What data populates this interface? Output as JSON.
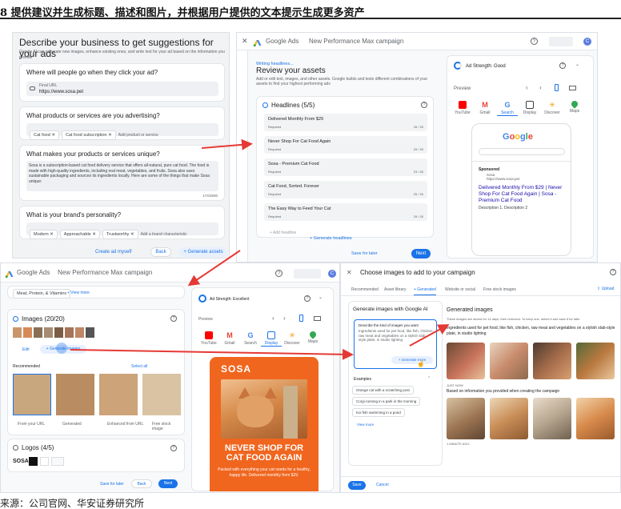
{
  "header": {
    "title": "8 提供建议并生成标题、描述和图片，并根据用户提供的文本提示生成更多资产"
  },
  "footer": {
    "source": "来源：公司官网、华安证券研究所"
  },
  "colors": {
    "accent": "#1a73e8",
    "arrow": "#e53935",
    "sosa_orange": "#f0661f"
  },
  "panel1": {
    "title": "Describe your business to get suggestions for your ads",
    "subtitle": "Google AI can generate new images, enhance existing ones, and write text for your ad based on the information you provide",
    "q1": "Where will people go when they click your ad?",
    "final_url_label": "Final URL",
    "final_url_value": "https://www.sosa.pet",
    "q2": "What products or services are you advertising?",
    "chips2": [
      "Cat food ✕",
      "Cat food subscription ✕"
    ],
    "add_product": "Add product or service",
    "q3": "What makes your products or services unique?",
    "unique_text": "Sosa is a subscription-based cat food delivery service that offers all-natural, pure cat food. The food is made with high-quality ingredients, including real meat, vegetables, and fruits. Sosa also uses sustainable packaging and sources its ingredients locally. Here are some of the things that make Sosa unique:",
    "counter": "174/2500",
    "q4": "What is your brand's personality?",
    "chips4": [
      "Modern ✕",
      "Approachable ✕",
      "Trustworthy ✕"
    ],
    "add_brand": "Add a brand characteristic",
    "create_manually": "Create ad myself",
    "back": "Back",
    "generate": "+ Generate assets"
  },
  "panel2": {
    "brand": "Google Ads",
    "campaign": "New Performance Max campaign",
    "writing": "Writing headlines...",
    "title": "Review your assets",
    "subtitle": "Add or edit text, images, and other assets. Google builds and tests different combinations of your assets to find your highest performing ads",
    "headlines_label": "Headlines (5/5)",
    "required": "Required",
    "headlines": [
      {
        "text": "Delivered Monthly From $29",
        "count": "26 / 30"
      },
      {
        "text": "Never Shop For Cat Food Again",
        "count": "29 / 30"
      },
      {
        "text": "Sosa - Premium Cat Food",
        "count": "23 / 30"
      },
      {
        "text": "Cat Food, Sorted. Forever",
        "count": "25 / 30"
      },
      {
        "text": "The Easy Way to Feed Your Cat",
        "count": "29 / 30"
      }
    ],
    "add_headline": "+ Add headline",
    "gen_headlines": "+ Generate headlines",
    "save_later": "Save for later",
    "next": "Next",
    "strength": "Ad Strength: Good",
    "preview": "Preview",
    "channels": [
      "YouTube",
      "Gmail",
      "Search",
      "Display",
      "Discover",
      "Maps"
    ],
    "sponsored": "Sponsored",
    "ad_site": "Sosa",
    "ad_url": "https://www.sosa.pet",
    "ad_title": "Delivered Monthly From $29 | Never Shop For Cat Food Again | Sosa - Premium Cat Food",
    "ad_desc": "Description 1. Description 2",
    "google": "Google"
  },
  "panel3": {
    "brand": "Google Ads",
    "campaign": "New Performance Max campaign",
    "tags": "Meat, Protein, & Vitamins",
    "view_more": "+ View more",
    "images_label": "Images (20/20)",
    "edit": "Edit",
    "gen_images": "+ Generate images",
    "recommended": "Recommended",
    "select_all": "Select all",
    "sources": [
      "From your URL",
      "Generated",
      "Enhanced from URL",
      "Free stock image"
    ],
    "logos_label": "Logos (4/5)",
    "logo_text": "SOSA",
    "save_later": "Save for later",
    "back": "Back",
    "next": "Next",
    "strength": "Ad Strength: Excellent",
    "preview": "Preview",
    "channels": [
      "YouTube",
      "Gmail",
      "Search",
      "Display",
      "Discover",
      "Maps"
    ],
    "ad_brand": "SOSA",
    "ad_headline": "NEVER SHOP FOR CAT FOOD AGAIN",
    "ad_body": "Packed with everything your cat needs for a healthy, happy life. Delivered monthly from $29."
  },
  "panel4": {
    "title": "Choose images to add to your campaign",
    "tabs": [
      "Recommended",
      "Asset library",
      "+ Generated",
      "Website or social",
      "Free stock images"
    ],
    "upload": "Upload",
    "gen_title": "Generate images with Google AI",
    "describe_label": "Describe the kind of images you want",
    "prompt": "Ingredients used for pet food, like fish, chicken, raw meat and vegetables on a stylish slab style plate, in studio lighting",
    "gen_more": "+ Generate more",
    "examples_label": "Examples",
    "examples": [
      "Orange cat with a scratching post",
      "Corgi running in a park in the morning",
      "Koi fish swimming in a pond"
    ],
    "view_more": "View more",
    "generated_title": "Generated images",
    "generated_note": "These images are stored for 14 days, then removed. To keep one, select it and save it for later",
    "prompt_echo": "Ingredients used for pet food, like fish, chicken, raw meat and vegetables on a stylish slab-style plate, in studio lighting",
    "just_now": "JUST NOW",
    "based_on": "Based on information you provided when creating the campaign",
    "time_ago": "1 MINUTE AGO",
    "save": "Save",
    "cancel": "Cancel"
  }
}
